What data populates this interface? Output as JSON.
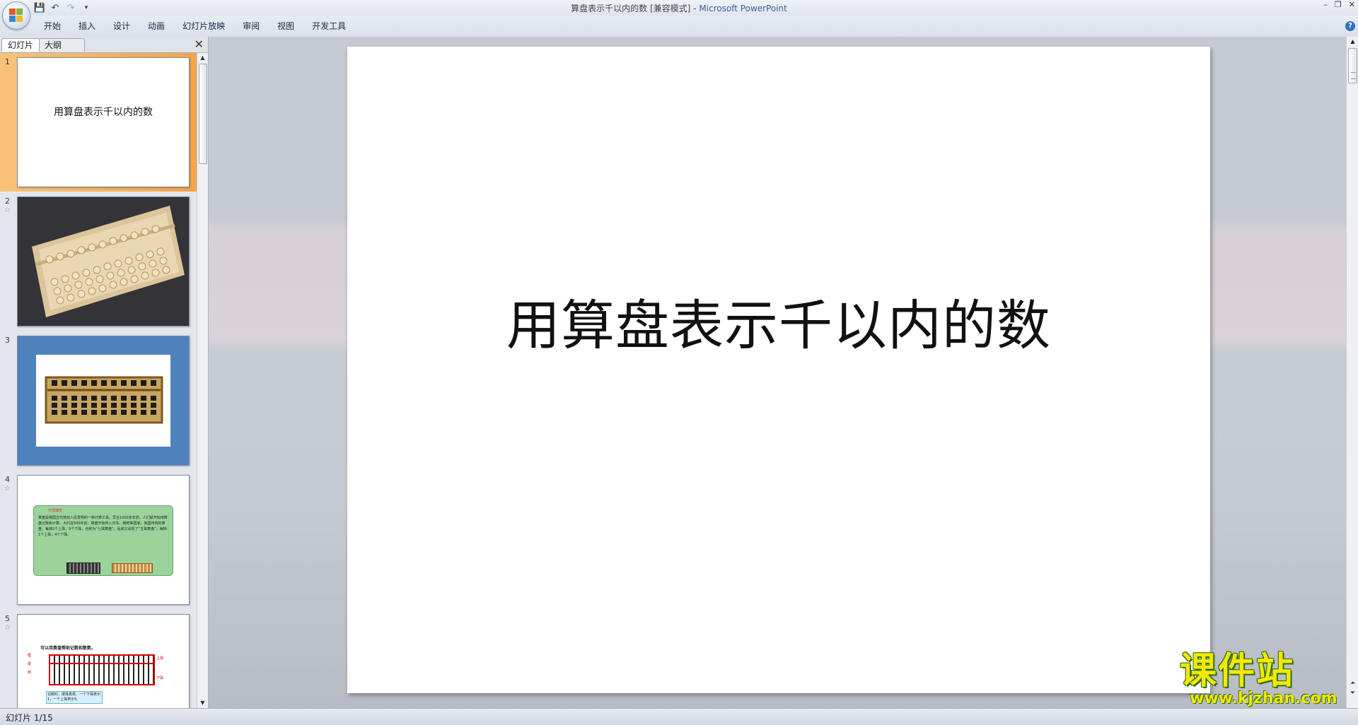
{
  "window": {
    "title_doc": "算盘表示千以内的数 [兼容模式] - ",
    "title_app": "Microsoft PowerPoint",
    "controls": [
      "–",
      "❐",
      "✕"
    ]
  },
  "quick_access": {
    "icons": [
      "save-icon",
      "undo-icon",
      "redo-icon",
      "customize-icon"
    ],
    "glyphs": [
      "💾",
      "↶",
      "↷",
      "▾"
    ]
  },
  "ribbon": {
    "tabs": [
      "开始",
      "插入",
      "设计",
      "动画",
      "幻灯片放映",
      "审阅",
      "视图",
      "开发工具"
    ],
    "help": "?"
  },
  "left_pane": {
    "tab_slides": "幻灯片",
    "tab_outline": "大纲",
    "close": "✕",
    "slides": [
      {
        "num": "1",
        "title": "用算盘表示千以内的数",
        "star": ""
      },
      {
        "num": "2",
        "title": "",
        "star": "☆"
      },
      {
        "num": "3",
        "title": "",
        "star": ""
      },
      {
        "num": "4",
        "title": "",
        "star": "☆"
      },
      {
        "num": "5",
        "title": "",
        "star": "☆"
      }
    ],
    "slide4_heading": "珍闻博览",
    "slide4_text": "算盘是我国古代劳动人民发明的一种计算工具。早在1000多年前，人们就开始用算盘记数和计算。大约在500年前，算盘开始传入日本、朝鲜等国家。我国传统的算盘，每档2个上珠，5个下珠，也称为“七珠算盘”。后来又出现了“五珠算盘”，每档1个上珠，4个下珠。",
    "slide5_heading": "可以用算盘帮助记数和数数。",
    "slide5_labels": [
      "框",
      "梁",
      "档",
      "上珠",
      "下珠"
    ],
    "slide5_note": "记数时，拨珠靠梁。一个下珠表示1，一个上珠表示5。"
  },
  "slide": {
    "title": "用算盘表示千以内的数"
  },
  "status": {
    "text": "幻灯片 1/15"
  },
  "watermark": {
    "main": "课件站",
    "url": "www.kjzhan.com"
  }
}
